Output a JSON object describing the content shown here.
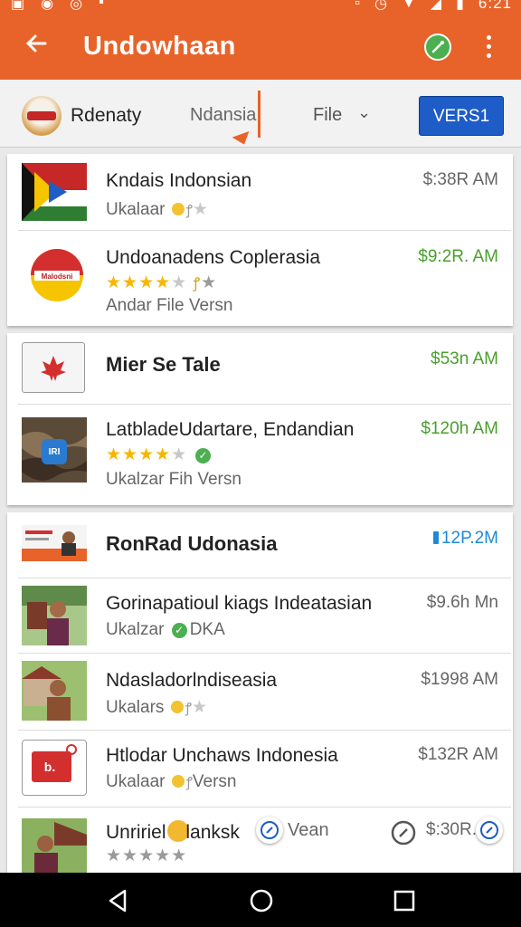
{
  "status_bar": {
    "clock": "6:21"
  },
  "app_bar": {
    "title": "Undowhaan"
  },
  "tab_row": {
    "brand": "Rdenaty",
    "tab_active": "Ndansia",
    "tab_file": "File",
    "vers_button": "VERS1"
  },
  "cards": [
    {
      "rows": [
        {
          "title": "Kndais Indonsian",
          "sub": "Ukalaar",
          "price": "$:38R AM"
        },
        {
          "title": "Undoanadens Coplerasia",
          "stars": 4,
          "sub": "Andar File  Versn",
          "price": "$9:2R. AM"
        }
      ]
    },
    {
      "rows": [
        {
          "title": "Mier Se Tale",
          "price": "$53n AM"
        },
        {
          "title": "LatbladeUdartare, Endandian",
          "stars": 4,
          "sub": "Ukalzar Fih  Versn",
          "price": "$120h AM"
        }
      ]
    },
    {
      "rows": [
        {
          "title": "RonRad Udonasia",
          "price": "12P.2M"
        },
        {
          "title": "Gorinapatioul kiags Indeatasian",
          "sub": "Ukalzar",
          "sub_badge": "DKA",
          "price": "$9.6h Mn"
        },
        {
          "title": "Ndasladorlndiseasia",
          "sub": "Ukalars",
          "price": "$1998 AM"
        },
        {
          "title": "Htlodar Unchaws Indonesia",
          "sub": "Ukalaar",
          "sub_after": "Versn",
          "price": "$132R AM"
        },
        {
          "title": "Unririel",
          "title_tail": "lanksk",
          "title_end": "Vean",
          "price": "$:30R."
        }
      ]
    }
  ],
  "colors": {
    "accent": "#e8632a",
    "brand_blue": "#1e5cc8",
    "green": "#4aa02c",
    "star": "#f6b700"
  }
}
